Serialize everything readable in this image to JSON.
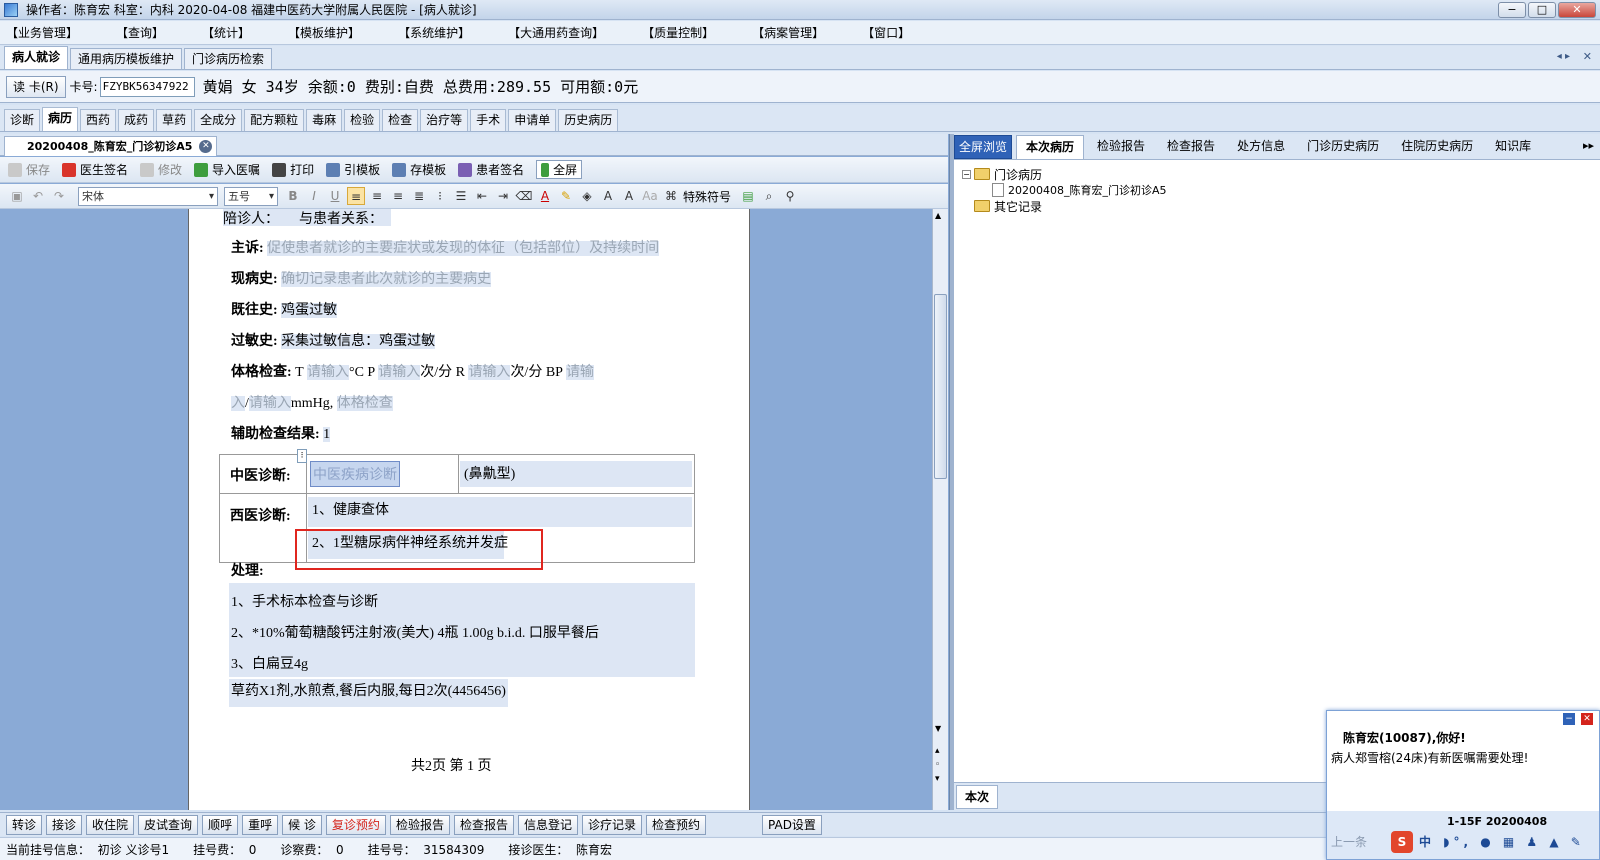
{
  "window": {
    "title": "操作者：陈育宏  科室：内科  2020-04-08  福建中医药大学附属人民医院 - [病人就诊]",
    "buttons": [
      "−",
      "□",
      "✕"
    ]
  },
  "menu": [
    "【业务管理】",
    "【查询】",
    "【统计】",
    "【模板维护】",
    "【系统维护】",
    "【大通用药查询】",
    "【质量控制】",
    "【病案管理】",
    "【窗口】"
  ],
  "nav_tabs": [
    "病人就诊",
    "通用病历模板维护",
    "门诊病历检索"
  ],
  "patient": {
    "read_card": "读 卡(R)",
    "card_label": "卡号:",
    "card_no": "FZYBK56347922",
    "info": "黄娟 女 34岁 余额:0 费别:自费 总费用:289.55 可用额:0元"
  },
  "mid_tabs": [
    "诊断",
    "病历",
    "西药",
    "成药",
    "草药",
    "全成分",
    "配方颗粒",
    "毒麻",
    "检验",
    "检查",
    "治疗等",
    "手术",
    "申请单",
    "历史病历"
  ],
  "doc_tab": "20200408_陈育宏_门诊初诊A5",
  "toolbar1": [
    "保存",
    "医生签名",
    "修改",
    "导入医嘱",
    "打印",
    "引模板",
    "存模板",
    "患者签名",
    "全屏"
  ],
  "toolbar2": {
    "font": "宋体",
    "size": "五号",
    "special": "特殊符号"
  },
  "record": {
    "companion_label": "陪诊人：",
    "relation_label": "与患者关系：",
    "chief_label": "主诉:",
    "chief_ph": "促使患者就诊的主要症状或发现的体征（包括部位）及持续时间",
    "present_label": "现病史:",
    "present_ph": "确切记录患者此次就诊的主要病史",
    "past_label": "既往史:",
    "past_val": "鸡蛋过敏",
    "allergy_label": "过敏史:",
    "allergy_val": "采集过敏信息：鸡蛋过敏",
    "exam_label": "体格检查:",
    "exam_t": "T",
    "ph_input": "请输入",
    "exam_c": "°C",
    "exam_p": "P",
    "unit_rate": "次/分",
    "exam_r": "R",
    "exam_bp": "BP",
    "ph_in1": "请输",
    "ph_in2": "入",
    "slash": "/",
    "mmhg": "mmHg,",
    "exam_ph": "体格检查",
    "aux_label": "辅助检查结果:",
    "aux_val": "1",
    "tcm_label": "中医诊断:",
    "tcm_ph": "中医疾病诊断",
    "tcm_type": "(鼻鼽型)",
    "wm_label": "西医诊断:",
    "wm_1": "1、健康查体",
    "wm_2": "2、1型糖尿病伴神经系统并发症",
    "treat_label": "处理:",
    "treat_1": "1、手术标本检查与诊断",
    "treat_2": "2、*10%葡萄糖酸钙注射液(美大)  4瓶  1.00g  b.i.d.  口服早餐后",
    "treat_3": "3、白扁豆4g",
    "treat_4": "草药X1剂,水煎煮,餐后内服,每日2次(4456456)",
    "pages": "共2页  第 1 页"
  },
  "right_tabs": [
    "全屏浏览",
    "本次病历",
    "检验报告",
    "检查报告",
    "处方信息",
    "门诊历史病历",
    "住院历史病历",
    "知识库"
  ],
  "tree": {
    "root": "门诊病历",
    "child": "20200408_陈育宏_门诊初诊A5",
    "other": "其它记录"
  },
  "right_bottom_tab": "本次",
  "bottom_buttons": [
    "转诊",
    "接诊",
    "收住院",
    "皮试查询",
    "顺呼",
    "重呼",
    "候 诊",
    "复诊预约",
    "检验报告",
    "检查报告",
    "信息登记",
    "诊疗记录",
    "检查预约",
    "PAD设置"
  ],
  "status": {
    "reg_info": "当前挂号信息：  初诊 义诊号1",
    "reg_fee": "挂号费：  0",
    "exam_fee": "诊察费：  0",
    "reg_no": "挂号号：  31584309",
    "doctor": "接诊医生：  陈育宏"
  },
  "popup": {
    "greeting": "陈育宏(10087),你好!",
    "message": "病人郑雪榕(24床)有新医嘱需要处理!",
    "footer": "1-15F 20200408",
    "prev": "上一条"
  },
  "colors": {
    "accent": "#2f62b7",
    "highlight_box": "#e0261f",
    "pane_bg": "#8aaad6"
  }
}
